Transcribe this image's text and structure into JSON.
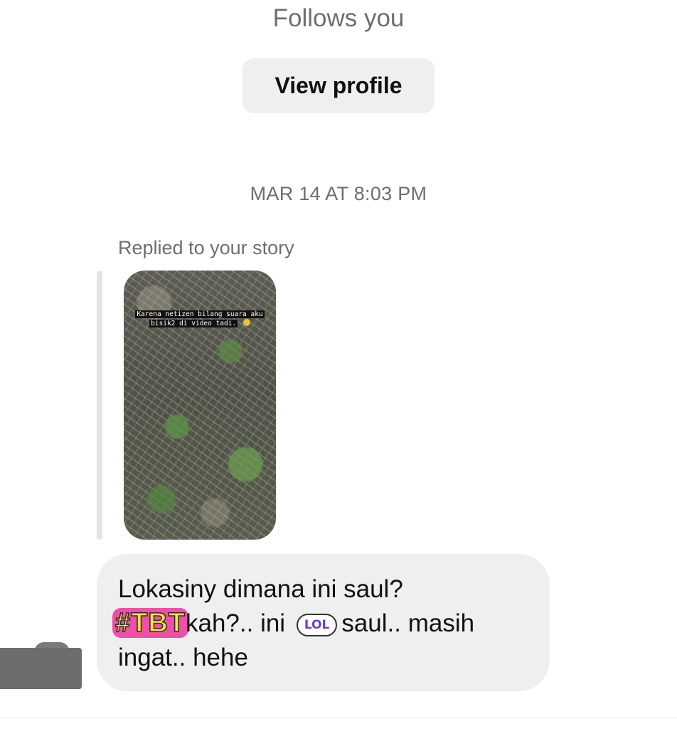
{
  "header": {
    "follows_text": "Follows you",
    "view_profile_label": "View profile"
  },
  "thread": {
    "timestamp": "MAR 14 AT 8:03 PM",
    "story_reply": {
      "label": "Replied to your story",
      "story_caption": "Karena netizen bilang suara aku bisik2 di video tadi."
    },
    "message": {
      "line1": "Lokasiny dimana ini saul?",
      "sticker_tbt": "#TBT",
      "line2_part1": "kah?.. ini",
      "sticker_lol": "LOL",
      "line2_part2": "saul.. masih",
      "line3": "ingat.. hehe"
    }
  },
  "colors": {
    "bubble_bg": "#efefef",
    "secondary_text": "#6e6e6e",
    "button_bg": "#efefef",
    "sticker_tbt_fill": "#ffe23a",
    "sticker_tbt_bg": "#f04fa8",
    "sticker_lol_text": "#6a3fc9"
  }
}
